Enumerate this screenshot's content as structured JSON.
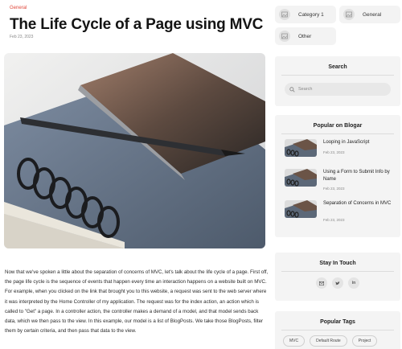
{
  "article": {
    "category": "General",
    "title": "The Life Cycle of a Page using MVC",
    "date": "Feb 23, 2023",
    "body": "Now that we've spoken a little about the separation of concerns of MVC, let's talk about the life cycle of a page. First off, the page life cycle is the sequence of events that happen every time an interaction happens on a website built on MVC. For example, when you clicked on the link that brought you to this website, a request was sent to the web server where it was interpreted by the Home Controller of my application. The request was for the index action, an action which is called to \"Get\" a page. In a controller action, the controller makes a demand of a model, and that model sends back data, which we then pass to the view. In this example, our model is a list of BlogPosts. We take those BlogPosts, filter them by certain criteria, and then pass that data to the view."
  },
  "categories": [
    {
      "label": "Category 1",
      "icon": "image-icon"
    },
    {
      "label": "General",
      "icon": "image-icon"
    },
    {
      "label": "Other",
      "icon": "image-icon"
    }
  ],
  "search": {
    "title": "Search",
    "placeholder": "Search"
  },
  "popular": {
    "title": "Popular on Blogar",
    "items": [
      {
        "title": "Looping in JavaScript",
        "date": "Feb 23, 2023"
      },
      {
        "title": "Using a Form to Submit Info by Name",
        "date": "Feb 23, 2023"
      },
      {
        "title": "Separation of Concerns in MVC",
        "date": "Feb 23, 2023"
      }
    ]
  },
  "stay": {
    "title": "Stay In Touch",
    "social": [
      {
        "icon": "mail-icon",
        "glyph": "✉"
      },
      {
        "icon": "twitter-icon",
        "glyph": "🐦"
      },
      {
        "icon": "linkedin-icon",
        "glyph": "in"
      }
    ]
  },
  "tags": {
    "title": "Popular Tags",
    "items": [
      "MVC",
      "Default Route",
      "Project"
    ]
  },
  "colors": {
    "accent": "#e0473a",
    "widget_bg": "#f4f4f4"
  }
}
